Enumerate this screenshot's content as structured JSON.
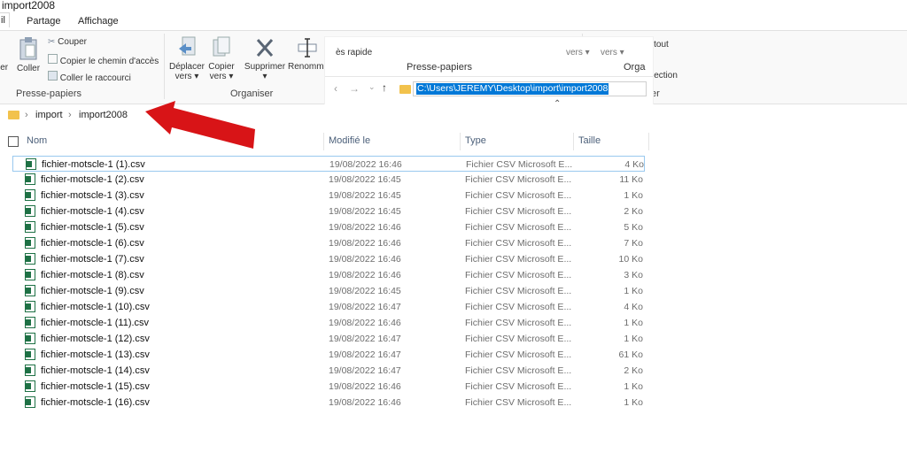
{
  "window": {
    "title": "import2008"
  },
  "tabs": [
    {
      "label": "il"
    },
    {
      "label": "Partage"
    },
    {
      "label": "Affichage"
    }
  ],
  "ribbon": {
    "clipboard": {
      "partial_label": "ier",
      "paste_label": "Coller",
      "cut_label": "Couper",
      "copy_path_label": "Copier le chemin d'accès",
      "paste_shortcut_label": "Coller le raccourci",
      "group_label": "Presse-papiers"
    },
    "organize": {
      "move_label": "Déplacer",
      "move_sub": "vers",
      "copy_label": "Copier",
      "copy_sub": "vers",
      "delete_label": "Supprimer",
      "rename_label": "Renomme",
      "group_label": "Organiser"
    },
    "right_partial": {
      "select_all_label": "Sélectionner tout",
      "selection_label": "lection",
      "er_label": "er"
    }
  },
  "overlay": {
    "quick_label": "ès rapide",
    "clipboard_label": "Presse-papiers",
    "vers1": "vers",
    "vers2": "vers",
    "orga_label": "Orga",
    "path": "C:\\Users\\JEREMY\\Desktop\\import\\import2008"
  },
  "breadcrumb": {
    "items": [
      "import",
      "import2008"
    ],
    "separator": "›"
  },
  "columns": {
    "name": "Nom",
    "modified": "Modifié le",
    "type": "Type",
    "size": "Taille"
  },
  "files": [
    {
      "name": "fichier-motscle-1 (1).csv",
      "date": "19/08/2022 16:46",
      "type": "Fichier CSV Microsoft E...",
      "size": "4 Ko"
    },
    {
      "name": "fichier-motscle-1 (2).csv",
      "date": "19/08/2022 16:45",
      "type": "Fichier CSV Microsoft E...",
      "size": "11 Ko"
    },
    {
      "name": "fichier-motscle-1 (3).csv",
      "date": "19/08/2022 16:45",
      "type": "Fichier CSV Microsoft E...",
      "size": "1 Ko"
    },
    {
      "name": "fichier-motscle-1 (4).csv",
      "date": "19/08/2022 16:45",
      "type": "Fichier CSV Microsoft E...",
      "size": "2 Ko"
    },
    {
      "name": "fichier-motscle-1 (5).csv",
      "date": "19/08/2022 16:46",
      "type": "Fichier CSV Microsoft E...",
      "size": "5 Ko"
    },
    {
      "name": "fichier-motscle-1 (6).csv",
      "date": "19/08/2022 16:46",
      "type": "Fichier CSV Microsoft E...",
      "size": "7 Ko"
    },
    {
      "name": "fichier-motscle-1 (7).csv",
      "date": "19/08/2022 16:46",
      "type": "Fichier CSV Microsoft E...",
      "size": "10 Ko"
    },
    {
      "name": "fichier-motscle-1 (8).csv",
      "date": "19/08/2022 16:46",
      "type": "Fichier CSV Microsoft E...",
      "size": "3 Ko"
    },
    {
      "name": "fichier-motscle-1 (9).csv",
      "date": "19/08/2022 16:45",
      "type": "Fichier CSV Microsoft E...",
      "size": "1 Ko"
    },
    {
      "name": "fichier-motscle-1 (10).csv",
      "date": "19/08/2022 16:47",
      "type": "Fichier CSV Microsoft E...",
      "size": "4 Ko"
    },
    {
      "name": "fichier-motscle-1 (11).csv",
      "date": "19/08/2022 16:46",
      "type": "Fichier CSV Microsoft E...",
      "size": "1 Ko"
    },
    {
      "name": "fichier-motscle-1 (12).csv",
      "date": "19/08/2022 16:47",
      "type": "Fichier CSV Microsoft E...",
      "size": "1 Ko"
    },
    {
      "name": "fichier-motscle-1 (13).csv",
      "date": "19/08/2022 16:47",
      "type": "Fichier CSV Microsoft E...",
      "size": "61 Ko"
    },
    {
      "name": "fichier-motscle-1 (14).csv",
      "date": "19/08/2022 16:47",
      "type": "Fichier CSV Microsoft E...",
      "size": "2 Ko"
    },
    {
      "name": "fichier-motscle-1 (15).csv",
      "date": "19/08/2022 16:46",
      "type": "Fichier CSV Microsoft E...",
      "size": "1 Ko"
    },
    {
      "name": "fichier-motscle-1 (16).csv",
      "date": "19/08/2022 16:46",
      "type": "Fichier CSV Microsoft E...",
      "size": "1 Ko"
    }
  ],
  "colors": {
    "accent": "#0078d7",
    "arrow": "#d81417",
    "folder": "#f2c24c",
    "excel": "#1e7145",
    "selection_border": "#99c9ef"
  },
  "icons": {
    "paste": "clipboard-icon",
    "cut": "scissors-icon",
    "move": "move-to-icon",
    "copy_to": "copy-to-icon",
    "delete": "delete-x-icon",
    "rename": "rename-icon",
    "file": "excel-csv-icon",
    "annotation": "red-arrow-icon"
  }
}
